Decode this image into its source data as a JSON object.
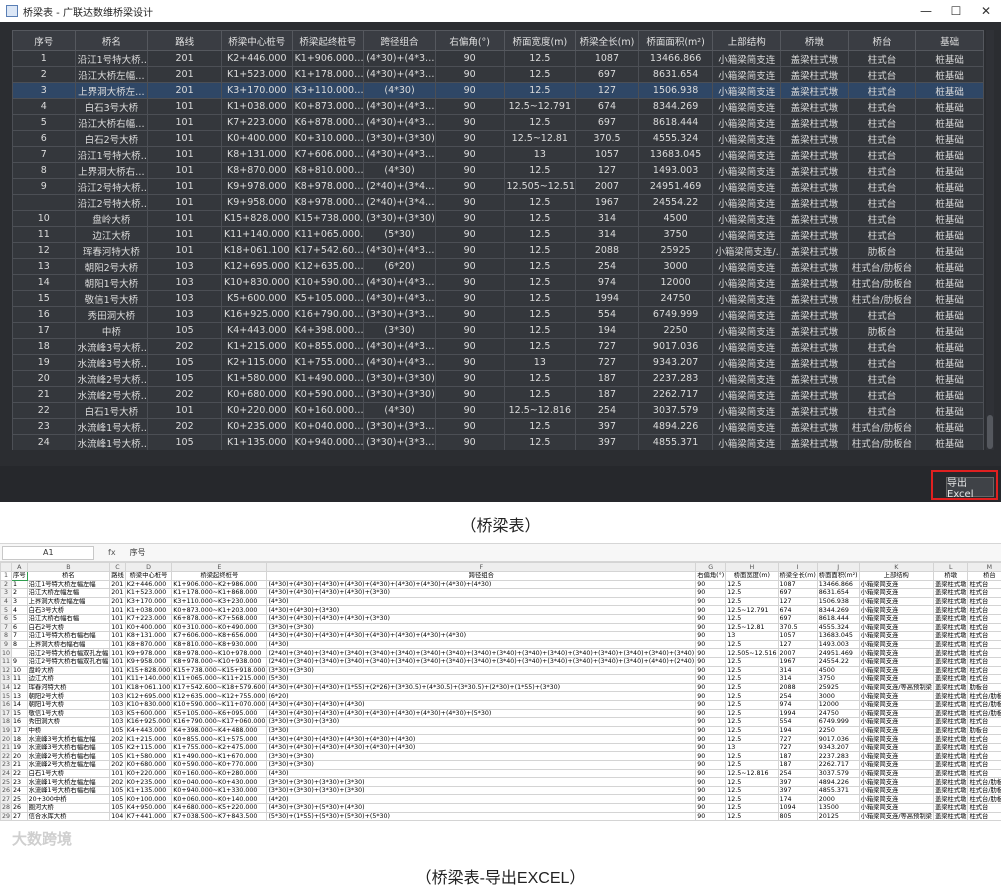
{
  "window": {
    "title": "桥梁表 - 广联达数维桥梁设计",
    "min": "—",
    "max": "☐",
    "close": "✕"
  },
  "grid": {
    "columns": [
      "序号",
      "桥名",
      "路线",
      "桥梁中心桩号",
      "桥梁起终桩号",
      "跨径组合",
      "右偏角(°)",
      "桥面宽度(m)",
      "桥梁全长(m)",
      "桥面面积(m²)",
      "上部结构",
      "桥墩",
      "桥台",
      "基础"
    ],
    "rows": [
      [
        "1",
        "沿江1号特大桥…",
        "201",
        "K2+446.000",
        "K1+906.000…",
        "(4*30)+(4*3…",
        "90",
        "12.5",
        "1087",
        "13466.866",
        "小箱梁简支连",
        "盖梁柱式墩",
        "柱式台",
        "桩基础"
      ],
      [
        "2",
        "沿江大桥左幅…",
        "201",
        "K1+523.000",
        "K1+178.000…",
        "(4*30)+(4*3…",
        "90",
        "12.5",
        "697",
        "8631.654",
        "小箱梁简支连",
        "盖梁柱式墩",
        "柱式台",
        "桩基础"
      ],
      [
        "3",
        "上界洞大桥左…",
        "201",
        "K3+170.000",
        "K3+110.000…",
        "(4*30)",
        "90",
        "12.5",
        "127",
        "1506.938",
        "小箱梁简支连",
        "盖梁柱式墩",
        "柱式台",
        "桩基础"
      ],
      [
        "4",
        "白石3号大桥",
        "101",
        "K1+038.000",
        "K0+873.000…",
        "(4*30)+(4*3…",
        "90",
        "12.5~12.791",
        "674",
        "8344.269",
        "小箱梁简支连",
        "盖梁柱式墩",
        "柱式台",
        "桩基础"
      ],
      [
        "5",
        "沿江大桥右幅…",
        "101",
        "K7+223.000",
        "K6+878.000…",
        "(4*30)+(4*3…",
        "90",
        "12.5",
        "697",
        "8618.444",
        "小箱梁简支连",
        "盖梁柱式墩",
        "柱式台",
        "桩基础"
      ],
      [
        "6",
        "白石2号大桥",
        "101",
        "K0+400.000",
        "K0+310.000…",
        "(3*30)+(3*30)",
        "90",
        "12.5~12.81",
        "370.5",
        "4555.324",
        "小箱梁简支连",
        "盖梁柱式墩",
        "柱式台",
        "桩基础"
      ],
      [
        "7",
        "沿江1号特大桥…",
        "101",
        "K8+131.000",
        "K7+606.000…",
        "(4*30)+(4*3…",
        "90",
        "13",
        "1057",
        "13683.045",
        "小箱梁简支连",
        "盖梁柱式墩",
        "柱式台",
        "桩基础"
      ],
      [
        "8",
        "上界洞大桥右…",
        "101",
        "K8+870.000",
        "K8+810.000…",
        "(4*30)",
        "90",
        "12.5",
        "127",
        "1493.003",
        "小箱梁简支连",
        "盖梁柱式墩",
        "柱式台",
        "桩基础"
      ],
      [
        "9",
        "沿江2号特大桥…",
        "101",
        "K9+978.000",
        "K8+978.000…",
        "(2*40)+(3*4…",
        "90",
        "12.505~12.516",
        "2007",
        "24951.469",
        "小箱梁简支连",
        "盖梁柱式墩",
        "柱式台",
        "桩基础"
      ],
      [
        "",
        "沿江2号特大桥…",
        "101",
        "K9+958.000",
        "K8+978.000…",
        "(2*40)+(3*4…",
        "90",
        "12.5",
        "1967",
        "24554.22",
        "小箱梁简支连",
        "盖梁柱式墩",
        "柱式台",
        "桩基础"
      ],
      [
        "10",
        "盘岭大桥",
        "101",
        "K15+828.000",
        "K15+738.000…",
        "(3*30)+(3*30)",
        "90",
        "12.5",
        "314",
        "4500",
        "小箱梁简支连",
        "盖梁柱式墩",
        "柱式台",
        "桩基础"
      ],
      [
        "11",
        "边江大桥",
        "101",
        "K11+140.000",
        "K11+065.000…",
        "(5*30)",
        "90",
        "12.5",
        "314",
        "3750",
        "小箱梁简支连",
        "盖梁柱式墩",
        "柱式台",
        "桩基础"
      ],
      [
        "12",
        "珲春河特大桥",
        "101",
        "K18+061.100",
        "K17+542.60…",
        "(4*30)+(4*3…",
        "90",
        "12.5",
        "2088",
        "25925",
        "小箱梁简支连/…",
        "盖梁柱式墩",
        "肋板台",
        "桩基础"
      ],
      [
        "13",
        "朝阳2号大桥",
        "103",
        "K12+695.000",
        "K12+635.00…",
        "(6*20)",
        "90",
        "12.5",
        "254",
        "3000",
        "小箱梁简支连",
        "盖梁柱式墩",
        "柱式台/肋板台",
        "桩基础"
      ],
      [
        "14",
        "朝阳1号大桥",
        "103",
        "K10+830.000",
        "K10+590.00…",
        "(4*30)+(4*3…",
        "90",
        "12.5",
        "974",
        "12000",
        "小箱梁简支连",
        "盖梁柱式墩",
        "柱式台/肋板台",
        "桩基础"
      ],
      [
        "15",
        "敬信1号大桥",
        "103",
        "K5+600.000",
        "K5+105.000…",
        "(4*30)+(4*3…",
        "90",
        "12.5",
        "1994",
        "24750",
        "小箱梁简支连",
        "盖梁柱式墩",
        "柱式台/肋板台",
        "桩基础"
      ],
      [
        "16",
        "秀田洞大桥",
        "103",
        "K16+925.000",
        "K16+790.00…",
        "(3*30)+(3*3…",
        "90",
        "12.5",
        "554",
        "6749.999",
        "小箱梁简支连",
        "盖梁柱式墩",
        "柱式台",
        "桩基础"
      ],
      [
        "17",
        "中桥",
        "105",
        "K4+443.000",
        "K4+398.000…",
        "(3*30)",
        "90",
        "12.5",
        "194",
        "2250",
        "小箱梁简支连",
        "盖梁柱式墩",
        "肋板台",
        "桩基础"
      ],
      [
        "18",
        "水流峰3号大桥…",
        "202",
        "K1+215.000",
        "K0+855.000…",
        "(4*30)+(4*3…",
        "90",
        "12.5",
        "727",
        "9017.036",
        "小箱梁简支连",
        "盖梁柱式墩",
        "柱式台",
        "桩基础"
      ],
      [
        "19",
        "水流峰3号大桥…",
        "105",
        "K2+115.000",
        "K1+755.000…",
        "(4*30)+(4*3…",
        "90",
        "13",
        "727",
        "9343.207",
        "小箱梁简支连",
        "盖梁柱式墩",
        "柱式台",
        "桩基础"
      ],
      [
        "20",
        "水流峰2号大桥…",
        "105",
        "K1+580.000",
        "K1+490.000…",
        "(3*30)+(3*30)",
        "90",
        "12.5",
        "187",
        "2237.283",
        "小箱梁简支连",
        "盖梁柱式墩",
        "柱式台",
        "桩基础"
      ],
      [
        "21",
        "水流峰2号大桥…",
        "202",
        "K0+680.000",
        "K0+590.000…",
        "(3*30)+(3*30)",
        "90",
        "12.5",
        "187",
        "2262.717",
        "小箱梁简支连",
        "盖梁柱式墩",
        "柱式台",
        "桩基础"
      ],
      [
        "22",
        "白石1号大桥",
        "101",
        "K0+220.000",
        "K0+160.000…",
        "(4*30)",
        "90",
        "12.5~12.816",
        "254",
        "3037.579",
        "小箱梁简支连",
        "盖梁柱式墩",
        "柱式台",
        "桩基础"
      ],
      [
        "23",
        "水流峰1号大桥…",
        "202",
        "K0+235.000",
        "K0+040.000…",
        "(3*30)+(3*3…",
        "90",
        "12.5",
        "397",
        "4894.226",
        "小箱梁简支连",
        "盖梁柱式墩",
        "柱式台/肋板台",
        "桩基础"
      ],
      [
        "24",
        "水流峰1号大桥…",
        "105",
        "K1+135.000",
        "K0+940.000…",
        "(3*30)+(3*3…",
        "90",
        "12.5",
        "397",
        "4855.371",
        "小箱梁简支连",
        "盖梁柱式墩",
        "柱式台/肋板台",
        "桩基础"
      ]
    ]
  },
  "export_button": "导出Excel",
  "caption_top": "（桥梁表）",
  "caption_bottom": "（桥梁表-导出EXCEL）",
  "excel": {
    "cell_ref": "A1",
    "fx": "fx",
    "formula_value": "序号",
    "col_letters": [
      "",
      "A",
      "B",
      "C",
      "D",
      "E",
      "F",
      "G",
      "H",
      "I",
      "J",
      "K",
      "L",
      "M",
      "N"
    ],
    "header": [
      "序号",
      "桥名",
      "路线",
      "桥梁中心桩号",
      "桥梁起终桩号",
      "跨径组合",
      "右偏角(°)",
      "桥面宽度(m)",
      "桥梁全长(m)",
      "桥面面积(m²)",
      "上部结构",
      "桥墩",
      "桥台",
      "基础"
    ],
    "rows": [
      [
        "1",
        "沿江1号特大桥左幅左幅",
        "201",
        "K2+446.000",
        "K1+906.000~K2+986.000",
        "(4*30)+(4*30)+(4*30)+(4*30)+(4*30)+(4*30)+(4*30)+(4*30)+(4*30)",
        "90",
        "12.5",
        "1087",
        "13466.866",
        "小箱梁简支连",
        "盖梁柱式墩",
        "柱式台",
        "桩基础"
      ],
      [
        "2",
        "沿江大桥左幅左幅",
        "201",
        "K1+523.000",
        "K1+178.000~K1+868.000",
        "(4*30)+(4*30)+(4*30)+(4*30)+(3*30)",
        "90",
        "12.5",
        "697",
        "8631.654",
        "小箱梁简支连",
        "盖梁柱式墩",
        "柱式台",
        "桩基础"
      ],
      [
        "3",
        "上界洞大桥左幅左幅",
        "201",
        "K3+170.000",
        "K3+110.000~K3+230.000",
        "(4*30)",
        "90",
        "12.5",
        "127",
        "1506.938",
        "小箱梁简支连",
        "盖梁柱式墩",
        "柱式台",
        "桩基础"
      ],
      [
        "4",
        "白石3号大桥",
        "101",
        "K1+038.000",
        "K0+873.000~K1+203.000",
        "(4*30)+(4*30)+(3*30)",
        "90",
        "12.5~12.791",
        "674",
        "8344.269",
        "小箱梁简支连",
        "盖梁柱式墩",
        "柱式台",
        "桩基础"
      ],
      [
        "5",
        "沿江大桥右幅右幅",
        "101",
        "K7+223.000",
        "K6+878.000~K7+568.000",
        "(4*30)+(4*30)+(4*30)+(4*30)+(3*30)",
        "90",
        "12.5",
        "697",
        "8618.444",
        "小箱梁简支连",
        "盖梁柱式墩",
        "柱式台",
        "桩基础"
      ],
      [
        "6",
        "白石2号大桥",
        "101",
        "K0+400.000",
        "K0+310.000~K0+490.000",
        "(3*30)+(3*30)",
        "90",
        "12.5~12.81",
        "370.5",
        "4555.324",
        "小箱梁简支连",
        "盖梁柱式墩",
        "柱式台",
        "桩基础"
      ],
      [
        "7",
        "沿江1号特大桥右幅右幅",
        "101",
        "K8+131.000",
        "K7+606.000~K8+656.000",
        "(4*30)+(4*30)+(4*30)+(4*30)+(4*30)+(4*30)+(4*30)+(4*30)",
        "90",
        "13",
        "1057",
        "13683.045",
        "小箱梁简支连",
        "盖梁柱式墩",
        "柱式台",
        "桩基础"
      ],
      [
        "8",
        "上界洞大桥右幅右幅",
        "101",
        "K8+870.000",
        "K8+810.000~K8+930.000",
        "(4*30)",
        "90",
        "12.5",
        "127",
        "1493.003",
        "小箱梁简支连",
        "盖梁柱式墩",
        "柱式台",
        "桩基础"
      ],
      [
        "",
        "沿江2号特大桥右幅双孔左幅",
        "101",
        "K9+978.000",
        "K8+978.000~K10+978.000",
        "(2*40)+(3*40)+(3*40)+(3*40)+(3*40)+(3*40)+(3*40)+(3*40)+(3*40)+(3*40)+(3*40)+(3*40)+(3*40)+(3*40)+(3*40)+(3*40)+(3*40)",
        "90",
        "12.505~12.516",
        "2007",
        "24951.469",
        "小箱梁简支连",
        "盖梁柱式墩",
        "柱式台",
        "桩基础"
      ],
      [
        "9",
        "沿江2号特大桥右幅双孔右幅",
        "101",
        "K9+958.000",
        "K8+978.000~K10+938.000",
        "(2*40)+(3*40)+(3*40)+(3*40)+(3*40)+(3*40)+(3*40)+(3*40)+(3*40)+(3*40)+(3*40)+(3*40)+(3*40)+(3*40)+(3*40)+(4*40)+(2*40)",
        "90",
        "12.5",
        "1967",
        "24554.22",
        "小箱梁简支连",
        "盖梁柱式墩",
        "柱式台",
        "桩基础"
      ],
      [
        "10",
        "盘岭大桥",
        "101",
        "K15+828.000",
        "K15+738.000~K15+918.000",
        "(3*30)+(3*30)",
        "90",
        "12.5",
        "314",
        "4500",
        "小箱梁简支连",
        "盖梁柱式墩",
        "柱式台",
        "桩基础"
      ],
      [
        "11",
        "边江大桥",
        "101",
        "K11+140.000",
        "K11+065.000~K11+215.000",
        "(5*30)",
        "90",
        "12.5",
        "314",
        "3750",
        "小箱梁简支连",
        "盖梁柱式墩",
        "柱式台",
        "桩基础"
      ],
      [
        "12",
        "珲春河特大桥",
        "101",
        "K18+061.100",
        "K17+542.600~K18+579.600",
        "(4*30)+(4*30)+(4*30)+(1*55)+(2*26)+(3*30.5)+(4*30.5)+(3*30.5)+(2*30)+(1*55)+(3*30)",
        "90",
        "12.5",
        "2088",
        "25925",
        "小箱梁简支连/等高预制梁",
        "盖梁柱式墩",
        "肋板台",
        "桩基础"
      ],
      [
        "13",
        "朝阳2号大桥",
        "103",
        "K12+695.000",
        "K12+635.000~K12+755.000",
        "(6*20)",
        "90",
        "12.5",
        "254",
        "3000",
        "小箱梁简支连",
        "盖梁柱式墩",
        "柱式台/肋板台",
        "桩基础"
      ],
      [
        "14",
        "朝阳1号大桥",
        "103",
        "K10+830.000",
        "K10+590.000~K11+070.000",
        "(4*30)+(4*30)+(4*30)+(4*30)",
        "90",
        "12.5",
        "974",
        "12000",
        "小箱梁简支连",
        "盖梁柱式墩",
        "柱式台/肋板台",
        "桩基础"
      ],
      [
        "15",
        "敬信1号大桥",
        "103",
        "K5+600.000",
        "K5+105.000~K6+095.000",
        "(4*30)+(4*30)+(4*30)+(4*30)+(4*30)+(4*30)+(4*30)+(4*30)+(5*30)",
        "90",
        "12.5",
        "1994",
        "24750",
        "小箱梁简支连",
        "盖梁柱式墩",
        "柱式台/肋板台",
        "桩基础"
      ],
      [
        "16",
        "秀田洞大桥",
        "103",
        "K16+925.000",
        "K16+790.000~K17+060.000",
        "(3*30)+(3*30)+(3*30)",
        "90",
        "12.5",
        "554",
        "6749.999",
        "小箱梁简支连",
        "盖梁柱式墩",
        "柱式台",
        "桩基础"
      ],
      [
        "17",
        "中桥",
        "105",
        "K4+443.000",
        "K4+398.000~K4+488.000",
        "(3*30)",
        "90",
        "12.5",
        "194",
        "2250",
        "小箱梁简支连",
        "盖梁柱式墩",
        "肋板台",
        "桩基础"
      ],
      [
        "18",
        "水流峰3号大桥右幅左幅",
        "202",
        "K1+215.000",
        "K0+855.000~K1+575.000",
        "(4*30)+(4*30)+(4*30)+(4*30)+(4*30)+(4*30)",
        "90",
        "12.5",
        "727",
        "9017.036",
        "小箱梁简支连",
        "盖梁柱式墩",
        "柱式台",
        "桩基础"
      ],
      [
        "19",
        "水流峰3号大桥右幅右幅",
        "105",
        "K2+115.000",
        "K1+755.000~K2+475.000",
        "(4*30)+(4*30)+(4*30)+(4*30)+(4*30)+(4*30)",
        "90",
        "13",
        "727",
        "9343.207",
        "小箱梁简支连",
        "盖梁柱式墩",
        "柱式台",
        "桩基础"
      ],
      [
        "20",
        "水流峰2号大桥右幅右幅",
        "105",
        "K1+580.000",
        "K1+490.000~K1+670.000",
        "(3*30)+(3*30)",
        "90",
        "12.5",
        "187",
        "2237.283",
        "小箱梁简支连",
        "盖梁柱式墩",
        "柱式台",
        "桩基础"
      ],
      [
        "21",
        "水流峰2号大桥左幅左幅",
        "202",
        "K0+680.000",
        "K0+590.000~K0+770.000",
        "(3*30)+(3*30)",
        "90",
        "12.5",
        "187",
        "2262.717",
        "小箱梁简支连",
        "盖梁柱式墩",
        "柱式台",
        "桩基础"
      ],
      [
        "22",
        "白石1号大桥",
        "101",
        "K0+220.000",
        "K0+160.000~K0+280.000",
        "(4*30)",
        "90",
        "12.5~12.816",
        "254",
        "3037.579",
        "小箱梁简支连",
        "盖梁柱式墩",
        "柱式台",
        "桩基础"
      ],
      [
        "23",
        "水流峰1号大桥左幅左幅",
        "202",
        "K0+235.000",
        "K0+040.000~K0+430.000",
        "(3*30)+(3*30)+(3*30)+(3*30)",
        "90",
        "12.5",
        "397",
        "4894.226",
        "小箱梁简支连",
        "盖梁柱式墩",
        "柱式台/肋板台",
        "桩基础"
      ],
      [
        "24",
        "水流峰1号大桥右幅右幅",
        "105",
        "K1+135.000",
        "K0+940.000~K1+330.000",
        "(3*30)+(3*30)+(3*30)+(3*30)",
        "90",
        "12.5",
        "397",
        "4855.371",
        "小箱梁简支连",
        "盖梁柱式墩",
        "柱式台/肋板台",
        "桩基础"
      ],
      [
        "25",
        "20+300中桥",
        "105",
        "K0+100.000",
        "K0+060.000~K0+140.000",
        "(4*20)",
        "90",
        "12.5",
        "174",
        "2000",
        "小箱梁简支连",
        "盖梁柱式墩",
        "柱式台/肋板台",
        "桩基础"
      ],
      [
        "26",
        "圈河大桥",
        "105",
        "K4+950.000",
        "K4+680.000~K5+220.000",
        "(4*30)+(3*30)+(5*30)+(4*30)",
        "90",
        "12.5",
        "1094",
        "13500",
        "小箱梁简支连",
        "盖梁柱式墩",
        "柱式台",
        "桩基础"
      ],
      [
        "27",
        "信合水库大桥",
        "104",
        "K7+441.000",
        "K7+038.500~K7+843.500",
        "(5*30)+(1*55)+(5*30)+(5*30)+(5*30)",
        "90",
        "12.5",
        "805",
        "20125",
        "小箱梁简支连/等高预制梁",
        "盖梁柱式墩",
        "柱式台",
        "桩基础"
      ]
    ]
  },
  "watermark": "大数跨境"
}
